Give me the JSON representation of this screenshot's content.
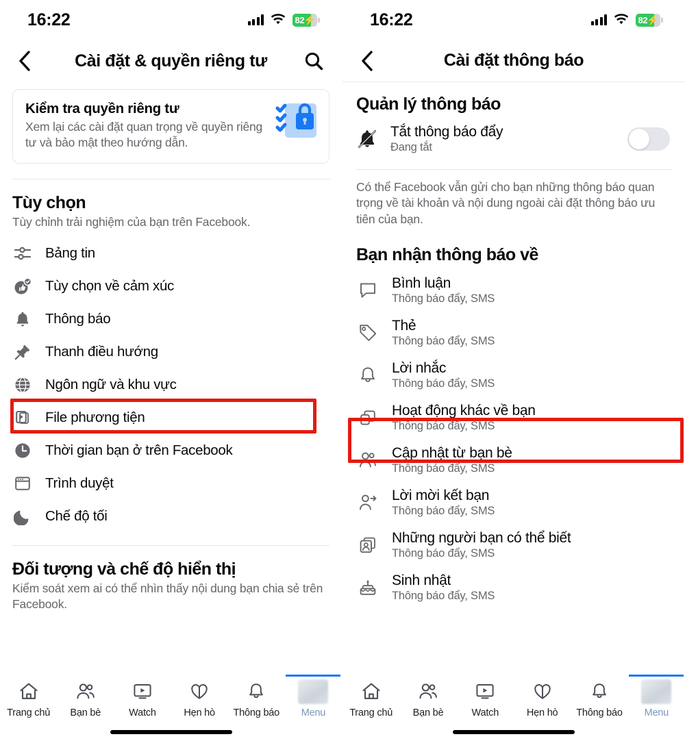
{
  "status_bar": {
    "time": "16:22",
    "battery_percent": "82",
    "signal_icon": "cellular-signal-icon",
    "wifi_icon": "wifi-icon",
    "battery_icon": "battery-charging-icon"
  },
  "left_screen": {
    "nav": {
      "back_icon": "chevron-left-icon",
      "title": "Cài đặt & quyền riêng tư",
      "search_icon": "search-icon"
    },
    "privacy_card": {
      "title": "Kiểm tra quyền riêng tư",
      "subtitle": "Xem lại các cài đặt quan trọng về quyền riêng tư và bảo mật theo hướng dẫn.",
      "illustration_icon": "privacy-checkup-lock-icon"
    },
    "preferences_section": {
      "title": "Tùy chọn",
      "subtitle": "Tùy chỉnh trải nghiệm của bạn trên Facebook.",
      "items": [
        {
          "label": "Bảng tin",
          "icon": "sliders-icon"
        },
        {
          "label": "Tùy chọn về cảm xúc",
          "icon": "thumbs-up-reaction-icon"
        },
        {
          "label": "Thông báo",
          "icon": "bell-icon",
          "highlighted": true
        },
        {
          "label": "Thanh điều hướng",
          "icon": "pushpin-icon"
        },
        {
          "label": "Ngôn ngữ và khu vực",
          "icon": "globe-icon"
        },
        {
          "label": "File phương tiện",
          "icon": "media-play-icon"
        },
        {
          "label": "Thời gian bạn ở trên Facebook",
          "icon": "clock-icon"
        },
        {
          "label": "Trình duyệt",
          "icon": "browser-window-icon"
        },
        {
          "label": "Chế độ tối",
          "icon": "moon-icon"
        }
      ]
    },
    "audience_section": {
      "title": "Đối tượng và chế độ hiển thị",
      "subtitle": "Kiểm soát xem ai có thể nhìn thấy nội dung bạn chia sẻ trên Facebook."
    }
  },
  "right_screen": {
    "nav": {
      "back_icon": "chevron-left-icon",
      "title": "Cài đặt thông báo"
    },
    "manage_section": {
      "title": "Quản lý thông báo",
      "toggle_row": {
        "icon": "bell-off-icon",
        "title": "Tắt thông báo đẩy",
        "subtitle": "Đang tắt",
        "toggle_state": "off"
      },
      "note": "Có thể Facebook vẫn gửi cho bạn những thông báo quan trọng về tài khoản và nội dung ngoài cài đặt thông báo ưu tiên của bạn."
    },
    "notifications_section": {
      "title": "Bạn nhận thông báo về",
      "items": [
        {
          "title": "Bình luận",
          "subtitle": "Thông báo đẩy, SMS",
          "icon": "comment-bubble-icon"
        },
        {
          "title": "Thẻ",
          "subtitle": "Thông báo đẩy, SMS",
          "icon": "tag-icon",
          "highlighted": true
        },
        {
          "title": "Lời nhắc",
          "subtitle": "Thông báo đẩy, SMS",
          "icon": "bell-outline-icon"
        },
        {
          "title": "Hoạt động khác về bạn",
          "subtitle": "Thông báo đẩy, SMS",
          "icon": "copy-squares-icon"
        },
        {
          "title": "Cập nhật từ bạn bè",
          "subtitle": "Thông báo đẩy, SMS",
          "icon": "two-people-icon"
        },
        {
          "title": "Lời mời kết bạn",
          "subtitle": "Thông báo đẩy, SMS",
          "icon": "person-add-icon"
        },
        {
          "title": "Những người bạn có thể biết",
          "subtitle": "Thông báo đẩy, SMS",
          "icon": "contact-card-icon"
        },
        {
          "title": "Sinh nhật",
          "subtitle": "Thông báo đẩy, SMS",
          "icon": "birthday-cake-icon"
        }
      ]
    }
  },
  "tab_bar": {
    "tabs": [
      {
        "label": "Trang chủ",
        "icon": "home-icon",
        "active": false
      },
      {
        "label": "Bạn bè",
        "icon": "friends-icon",
        "active": false
      },
      {
        "label": "Watch",
        "icon": "watch-video-icon",
        "active": false
      },
      {
        "label": "Hẹn hò",
        "icon": "dating-hearts-icon",
        "active": false
      },
      {
        "label": "Thông báo",
        "icon": "bell-icon",
        "active": false
      },
      {
        "label": "Menu",
        "icon": "menu-avatar-icon",
        "active": true
      }
    ]
  },
  "colors": {
    "highlight_red": "#e31b12",
    "accent_blue": "#1878f3",
    "battery_green": "#33c85a",
    "secondary_text": "#65676b"
  }
}
